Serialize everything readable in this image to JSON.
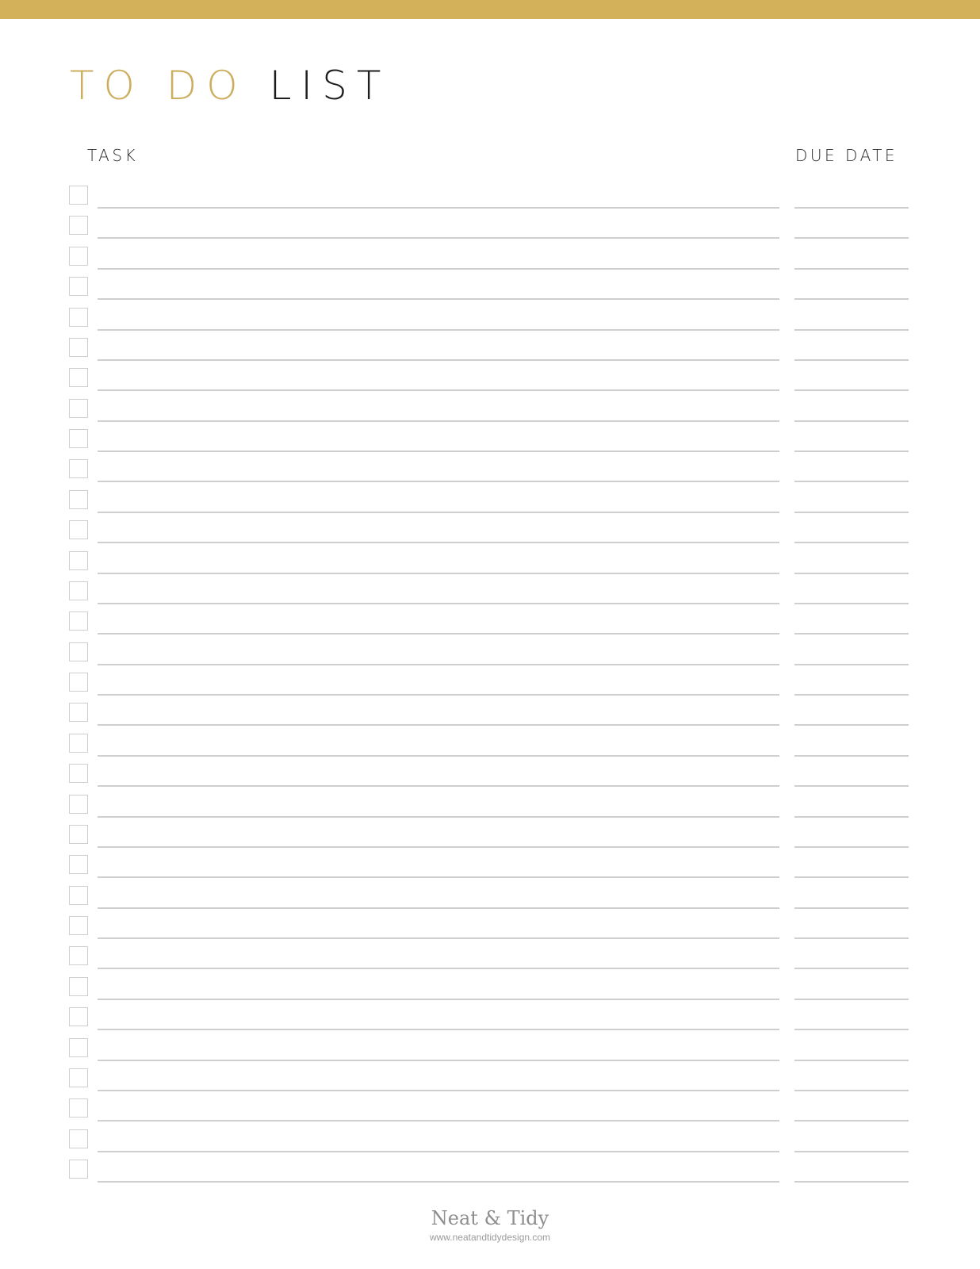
{
  "header": {
    "title_accent": "TO DO",
    "title_main": "LIST",
    "accent_color": "#d3b15b"
  },
  "columns": {
    "task": "TASK",
    "due_date": "DUE DATE"
  },
  "rows": {
    "count": 33,
    "items": []
  },
  "footer": {
    "brand": "Neat & Tidy",
    "url": "www.neatandtidydesign.com"
  }
}
